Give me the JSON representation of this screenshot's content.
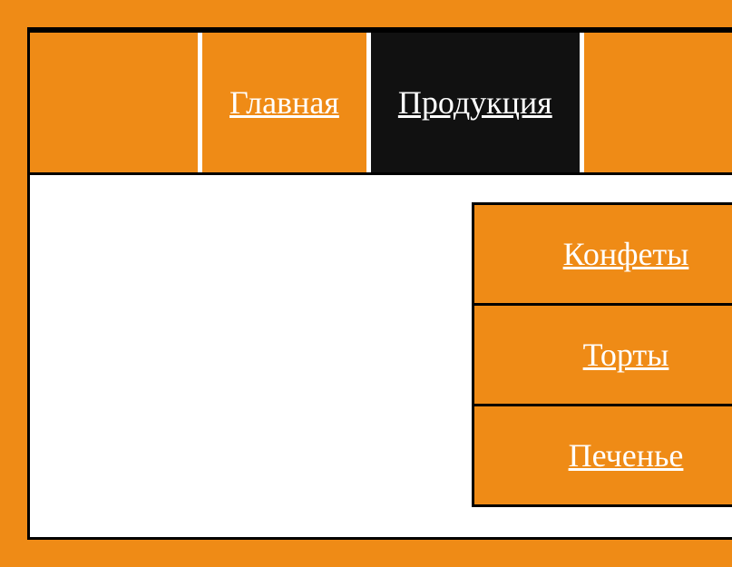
{
  "nav": {
    "items": [
      {
        "label": "Главная"
      },
      {
        "label": "Продукция"
      }
    ]
  },
  "dropdown": {
    "items": [
      {
        "label": "Конфеты"
      },
      {
        "label": "Торты"
      },
      {
        "label": "Печенье"
      }
    ]
  }
}
